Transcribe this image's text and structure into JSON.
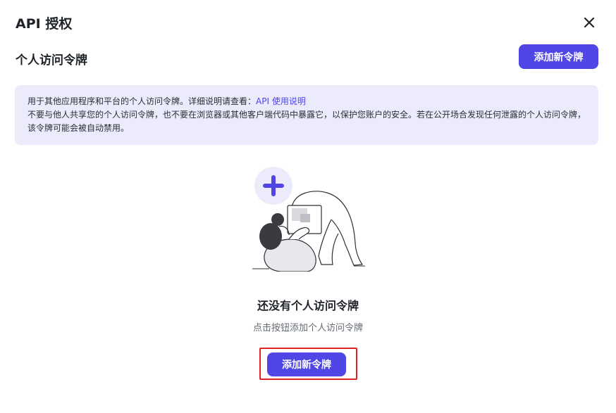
{
  "dialog": {
    "title": "API 授权",
    "close_icon": "close-icon"
  },
  "section": {
    "title": "个人访问令牌",
    "add_button_label": "添加新令牌"
  },
  "notice": {
    "line1_text": "用于其他应用程序和平台的个人访问令牌。详细说明请查看：",
    "line1_link": "API 使用说明",
    "line2_text": "不要与他人共享您的个人访问令牌，也不要在浏览器或其他客户端代码中暴露它，以保护您账户的安全。若在公开场合发现任何泄露的个人访问令牌，该令牌可能会被自动禁用。"
  },
  "empty_state": {
    "illustration_icon": "person-with-laptop-illustration",
    "title": "还没有个人访问令牌",
    "subtitle": "点击按钮添加个人访问令牌",
    "add_button_label": "添加新令牌"
  },
  "colors": {
    "accent": "#4f46e5",
    "notice_bg": "#ebebfb",
    "highlight": "#e02424"
  }
}
